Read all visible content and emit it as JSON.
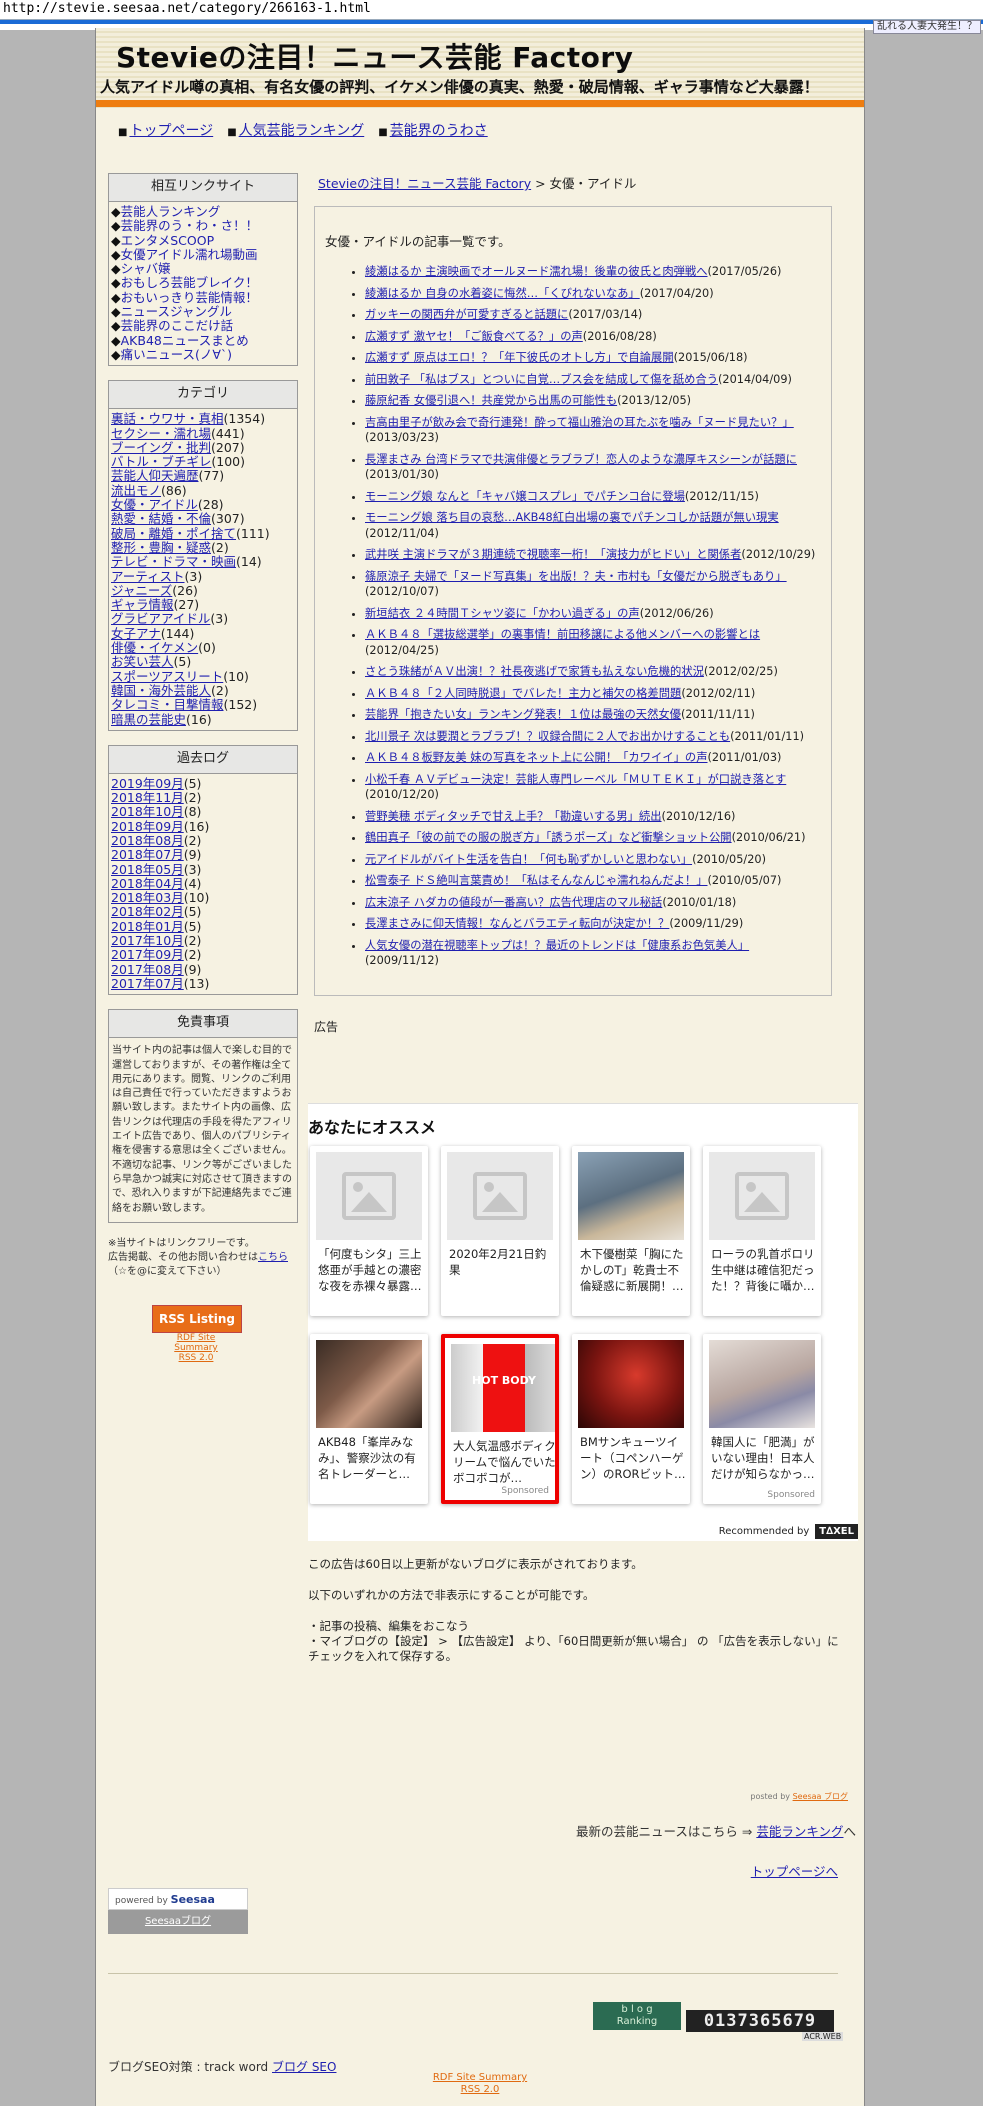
{
  "browser": {
    "url": "http://stevie.seesaa.net/category/266163-1.html",
    "promo_tag": "乱れる人妻大発生！？"
  },
  "header": {
    "title": "Stevieの注目！ニュース芸能 Factory",
    "subtitle": "人気アイドル噂の真相、有名女優の評判、イケメン俳優の真実、熱愛・破局情報、ギャラ事情など大暴露！"
  },
  "topnav": [
    {
      "label": "トップページ"
    },
    {
      "label": "人気芸能ランキング"
    },
    {
      "label": "芸能界のうわさ"
    }
  ],
  "sidebar": {
    "links_title": "相互リンクサイト",
    "links": [
      "芸能人ランキング",
      "芸能界のう・わ・さ！！",
      "エンタメSCOOP",
      "女優アイドル濡れ場動画",
      "シャバ嬢",
      "おもしろ芸能ブレイク！",
      "おもいっきり芸能情報！",
      "ニュースジャングル",
      "芸能界のここだけ話",
      "AKB48ニュースまとめ",
      "痛いニュース(ノ∀`)"
    ],
    "category_title": "カテゴリ",
    "categories": [
      {
        "name": "裏話・ウワサ・真相",
        "count": "(1354)"
      },
      {
        "name": "セクシー・濡れ場",
        "count": "(441)"
      },
      {
        "name": "ブーイング・批判",
        "count": "(207)"
      },
      {
        "name": "バトル・ブチギレ",
        "count": "(100)"
      },
      {
        "name": "芸能人仰天遍歴",
        "count": "(77)"
      },
      {
        "name": "流出モノ",
        "count": "(86)"
      },
      {
        "name": "女優・アイドル",
        "count": "(28)"
      },
      {
        "name": "熱愛・結婚・不倫",
        "count": "(307)"
      },
      {
        "name": "破局・離婚・ポイ捨て",
        "count": "(111)"
      },
      {
        "name": "整形・豊胸・疑惑",
        "count": "(2)"
      },
      {
        "name": "テレビ・ドラマ・映画",
        "count": "(14)"
      },
      {
        "name": "アーティスト",
        "count": "(3)"
      },
      {
        "name": "ジャニーズ",
        "count": "(26)"
      },
      {
        "name": "ギャラ情報",
        "count": "(27)"
      },
      {
        "name": "グラビアアイドル",
        "count": "(3)"
      },
      {
        "name": "女子アナ",
        "count": "(144)"
      },
      {
        "name": "俳優・イケメン",
        "count": "(0)"
      },
      {
        "name": "お笑い芸人",
        "count": "(5)"
      },
      {
        "name": "スポーツアスリート",
        "count": "(10)"
      },
      {
        "name": "韓国・海外芸能人",
        "count": "(2)"
      },
      {
        "name": "タレコミ・目撃情報",
        "count": "(152)"
      },
      {
        "name": "暗黒の芸能史",
        "count": "(16)"
      }
    ],
    "archive_title": "過去ログ",
    "archives": [
      {
        "name": "2019年09月",
        "count": "(5)"
      },
      {
        "name": "2018年11月",
        "count": "(2)"
      },
      {
        "name": "2018年10月",
        "count": "(8)"
      },
      {
        "name": "2018年09月",
        "count": "(16)"
      },
      {
        "name": "2018年08月",
        "count": "(2)"
      },
      {
        "name": "2018年07月",
        "count": "(9)"
      },
      {
        "name": "2018年05月",
        "count": "(3)"
      },
      {
        "name": "2018年04月",
        "count": "(4)"
      },
      {
        "name": "2018年03月",
        "count": "(10)"
      },
      {
        "name": "2018年02月",
        "count": "(5)"
      },
      {
        "name": "2018年01月",
        "count": "(5)"
      },
      {
        "name": "2017年10月",
        "count": "(2)"
      },
      {
        "name": "2017年09月",
        "count": "(2)"
      },
      {
        "name": "2017年08月",
        "count": "(9)"
      },
      {
        "name": "2017年07月",
        "count": "(13)"
      }
    ],
    "disclaimer_title": "免責事項",
    "disclaimer_text": "当サイト内の記事は個人で楽しむ目的で運営しておりますが、その著作権は全て用元にあります。閲覧、リンクのご利用は自己責任で行っていただきますようお願い致します。またサイト内の画像、広告リンクは代理店の手段を得たアフィリエイト広告であり、個人のパブリシティ権を侵害する意思は全くございません。不適切な記事、リンク等がございましたら早急かつ誠実に対応させて頂きますので、恐れ入りますが下記連絡先までご連絡をお願い致します。",
    "note_line1": "※当サイトはリンクフリーです。",
    "note_line2_prefix": "広告掲載、その他お問い合わせは",
    "note_link": "こちら",
    "note_line3": "（☆を@に変えて下さい）",
    "rss_badge": "RSS Listing",
    "rss_link1": "RDF Site Summary",
    "rss_link2": "RSS 2.0"
  },
  "content": {
    "breadcrumb_home": "Stevieの注目！ニュース芸能 Factory",
    "breadcrumb_sep": " > ",
    "breadcrumb_current": "女優・アイドル",
    "list_lead": "女優・アイドルの記事一覧です。",
    "articles": [
      {
        "title": "綾瀬はるか 主演映画でオールヌード濡れ場！後輩の彼氏と肉弾戦へ",
        "date": "(2017/05/26)"
      },
      {
        "title": "綾瀬はるか 自身の水着姿に悔然…「くびれないなあ」",
        "date": "(2017/04/20)"
      },
      {
        "title": "ガッキーの関西弁が可愛すぎると話題に",
        "date": "(2017/03/14)"
      },
      {
        "title": "広瀬すず 激ヤセ！「ご飯食べてる？」の声",
        "date": "(2016/08/28)"
      },
      {
        "title": "広瀬すず 原点はエロ！？「年下彼氏のオトし方」で自論展開",
        "date": "(2015/06/18)"
      },
      {
        "title": "前田敦子 「私はブス」とついに自覚…ブス会を結成して傷を舐め合う",
        "date": "(2014/04/09)"
      },
      {
        "title": "藤原紀香 女優引退へ！共産党から出馬の可能性も",
        "date": "(2013/12/05)"
      },
      {
        "title": "吉高由里子が飲み会で奇行連発！酔って福山雅治の耳たぶを噛み「ヌード見たい？」",
        "date": "(2013/03/23)"
      },
      {
        "title": "長澤まさみ 台湾ドラマで共演俳優とラブラブ！恋人のような濃厚キスシーンが話題に",
        "date": "(2013/01/30)"
      },
      {
        "title": "モーニング娘 なんと「キャバ嬢コスプレ」でパチンコ台に登場",
        "date": "(2012/11/15)"
      },
      {
        "title": "モーニング娘 落ち目の哀愁…AKB48紅白出場の裏でパチンコしか話題が無い現実",
        "date": "(2012/11/04)"
      },
      {
        "title": "武井咲 主演ドラマが３期連続で視聴率一桁！「演技力がヒドい」と関係者",
        "date": "(2012/10/29)"
      },
      {
        "title": "篠原涼子 夫婦で「ヌード写真集」を出版！？夫・市村も「女優だから脱ぎもあり」",
        "date": "(2012/10/07)"
      },
      {
        "title": "新垣結衣 ２４時間Ｔシャツ姿に「かわい過ぎる」の声",
        "date": "(2012/06/26)"
      },
      {
        "title": "ＡＫＢ４８「選抜総選挙」の裏事情！前田移譲による他メンバーへの影響とは",
        "date": "(2012/04/25)"
      },
      {
        "title": "さとう珠緒がＡＶ出演！？社長夜逃げで家賃も払えない危機的状況",
        "date": "(2012/02/25)"
      },
      {
        "title": "ＡＫＢ４８「２人同時脱退」でバレた！主力と補欠の格差問題",
        "date": "(2012/02/11)"
      },
      {
        "title": "芸能界「抱きたい女」ランキング発表！１位は最強の天然女優",
        "date": "(2011/11/11)"
      },
      {
        "title": "北川景子 次は要潤とラブラブ！？収録合間に２人でお出かけすることも",
        "date": "(2011/01/11)"
      },
      {
        "title": "ＡＫＢ４８板野友美 妹の写真をネット上に公開！「カワイイ」の声",
        "date": "(2011/01/03)"
      },
      {
        "title": "小松千春 ＡＶデビュー決定！芸能人専門レーベル「ＭＵＴＥＫＩ」が口説き落とす",
        "date": "(2010/12/20)"
      },
      {
        "title": "菅野美穂 ボディタッチで甘え上手？「勘違いする男」続出",
        "date": "(2010/12/16)"
      },
      {
        "title": "鶴田真子「彼の前での服の脱ぎ方」「誘うポーズ」など衝撃ショット公開",
        "date": "(2010/06/21)"
      },
      {
        "title": "元アイドルがバイト生活を告白！「何も恥ずかしいと思わない」",
        "date": "(2010/05/20)"
      },
      {
        "title": "松雪泰子 ドＳ絶叫言葉責め！「私はそんなんじゃ濡れねんだよ！」",
        "date": "(2010/05/07)"
      },
      {
        "title": "広末涼子 ハダカの値段が一番高い？広告代理店のマル秘話",
        "date": "(2010/01/18)"
      },
      {
        "title": "長澤まさみに仰天情報！なんとバラエティ転向が決定か！？",
        "date": "(2009/11/29)"
      },
      {
        "title": "人気女優の潜在視聴率トップは！？最近のトレンドは「健康系お色気美人」",
        "date": "(2009/11/12)"
      }
    ],
    "ad_label": "広告",
    "rec_title": "あなたにオススメ",
    "rec_cards": [
      {
        "caption": "「何度もシタ」三上悠亜が手越との濃密な夜を赤裸々暴露…",
        "sponsored": ""
      },
      {
        "caption": "2020年2月21日釣果",
        "sponsored": ""
      },
      {
        "caption": "木下優樹菜「胸にたかしのT」乾貴士不倫疑惑に新展開！…",
        "sponsored": ""
      },
      {
        "caption": "ローラの乳首ポロリ生中継は確信犯だった！？背後に囁か…",
        "sponsored": ""
      },
      {
        "caption": "AKB48「峯岸みなみ」、警察沙汰の有名トレーダーと…",
        "sponsored": ""
      },
      {
        "caption": "大人気温感ボディクリームで悩んでいたボコボコが…",
        "sponsored": "Sponsored"
      },
      {
        "caption": "BMサンキューツイート（コペンハーゲン）のRORビット…",
        "sponsored": ""
      },
      {
        "caption": "韓国人に「肥満」がいない理由！日本人だけが知らなかっ…",
        "sponsored": "Sponsored"
      }
    ],
    "hot_label": "HOT BODY",
    "recommended_by": "Recommended by",
    "recommended_logo": "T∆XEL",
    "ad_note_1": "この広告は60日以上更新がないブログに表示がされております。",
    "ad_note_2": "以下のいずれかの方法で非表示にすることが可能です。",
    "ad_note_3": "・記事の投稿、編集をおこなう",
    "ad_note_4": "・マイブログの【設定】 > 【広告設定】 より、「60日間更新が無い場合」 の 「広告を表示しない」にチェックを入れて保存する。",
    "posted_by_prefix": "posted by ",
    "posted_by_link": "Seesaa ブログ",
    "latest_prefix": "最新の芸能ニュースはこちら ⇒ ",
    "latest_link": "芸能ランキング",
    "latest_suffix": "へ",
    "toppage_link": "トップページへ"
  },
  "footer": {
    "powered_text": "powered by",
    "powered_brand": "Seesaa",
    "seesaa_blog": "Seesaaブログ",
    "rank_line1": "b l o g",
    "rank_line2": "Ranking",
    "counter": "0137365679",
    "counter_tag": "ACR.WEB",
    "seo_alt": "ブログSEO対策 : track word",
    "seo_link": "ブログ SEO",
    "rss_link1": "RDF Site Summary",
    "rss_link2": "RSS 2.0"
  }
}
